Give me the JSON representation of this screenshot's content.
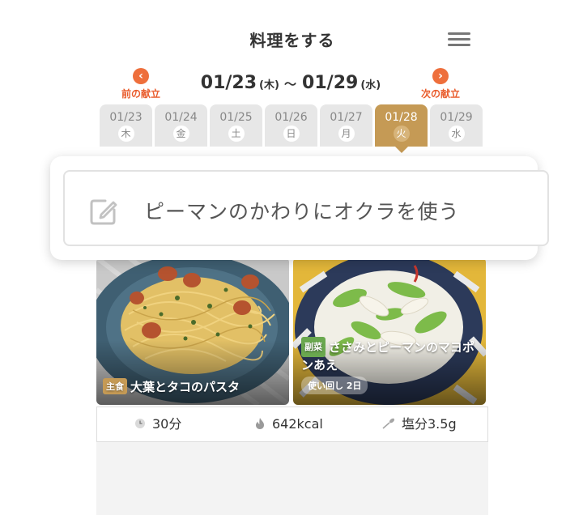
{
  "header": {
    "title": "料理をする",
    "menu_icon": "hamburger-menu-icon"
  },
  "week_nav": {
    "prev_label": "前の献立",
    "next_label": "次の献立",
    "start_date": "01/23",
    "start_weekday": "(木)",
    "separator": "～",
    "end_date": "01/29",
    "end_weekday": "(水)",
    "accent_color": "#ee6f3c"
  },
  "day_tabs": [
    {
      "date": "01/23",
      "weekday": "木",
      "active": false
    },
    {
      "date": "01/24",
      "weekday": "金",
      "active": false
    },
    {
      "date": "01/25",
      "weekday": "土",
      "active": false
    },
    {
      "date": "01/26",
      "weekday": "日",
      "active": false
    },
    {
      "date": "01/27",
      "weekday": "月",
      "active": false
    },
    {
      "date": "01/28",
      "weekday": "火",
      "active": true
    },
    {
      "date": "01/29",
      "weekday": "水",
      "active": false
    }
  ],
  "active_tab_color": "#c59a55",
  "popup": {
    "text": "ピーマンのかわりにオクラを使う",
    "icon": "edit-icon"
  },
  "main_dish": {
    "tag": "主食",
    "name": "大葉とタコのパスタ"
  },
  "side_dish": {
    "tag": "副菜",
    "name": "ささみとピーマンのマヨポンあえ",
    "reuse_label": "使い回し 2日"
  },
  "stats": {
    "time": "30分",
    "kcal": "642kcal",
    "salt": "塩分3.5g"
  }
}
